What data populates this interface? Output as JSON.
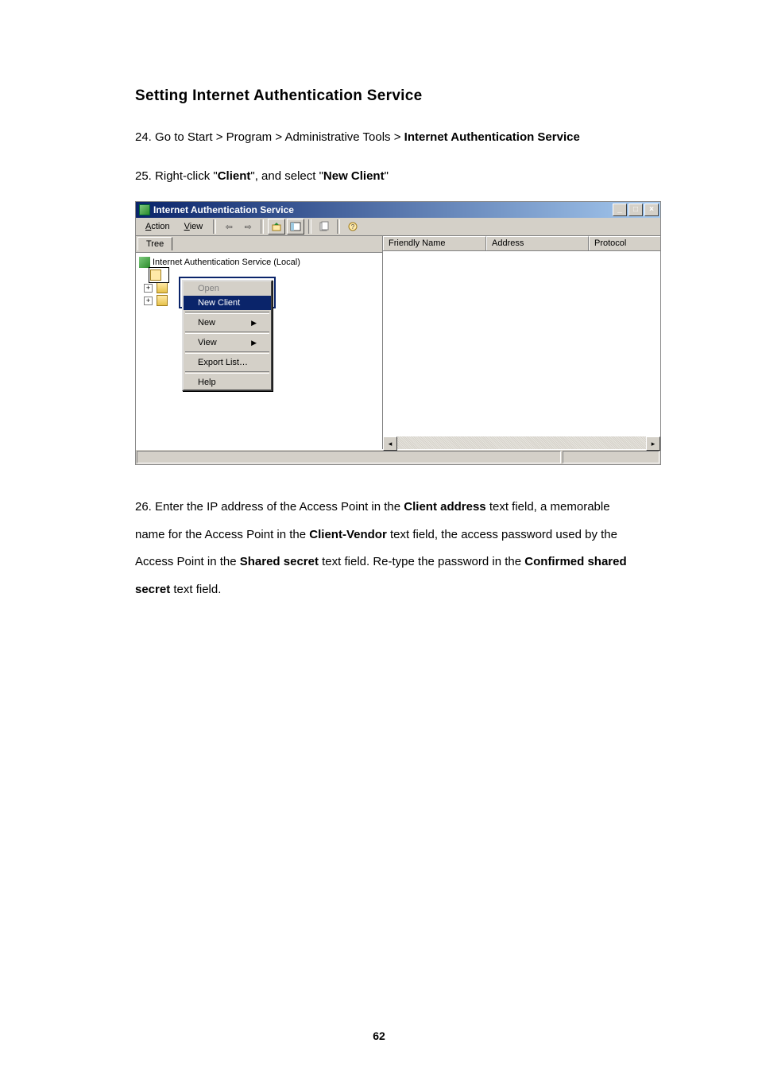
{
  "heading": "Setting Internet Authentication Service",
  "steps": {
    "s24": {
      "num": "24.",
      "prefix": "Go to Start > Program > Administrative Tools > ",
      "bold": "Internet Authentication Service"
    },
    "s25": {
      "num": "25.",
      "p1": "Right-click \"",
      "b1": "Client",
      "p2": "\", and select \"",
      "b2": "New Client",
      "p3": "\""
    },
    "s26": {
      "num": "26.",
      "t1": "Enter the IP address of the Access Point in the ",
      "b1": "Client address",
      "t2": " text field, a memorable name for the Access Point in the ",
      "b2": "Client-Vendor",
      "t3": " text field, the access password used by the Access Point in the ",
      "b3": "Shared secret",
      "t4": " text field. Re-type the password in the ",
      "b4": "Confirmed shared secret",
      "t5": " text field."
    }
  },
  "win": {
    "title": "Internet Authentication Service",
    "menus": {
      "action": "Action",
      "view": "View"
    },
    "tree_tab": "Tree",
    "root": "Internet Authentication Service (Local)",
    "ctx": {
      "open": "Open",
      "new_client": "New Client",
      "new": "New",
      "view": "View",
      "export": "Export List…",
      "help": "Help"
    },
    "cols": {
      "c1": "Friendly Name",
      "c2": "Address",
      "c3": "Protocol"
    }
  },
  "page_number": "62"
}
